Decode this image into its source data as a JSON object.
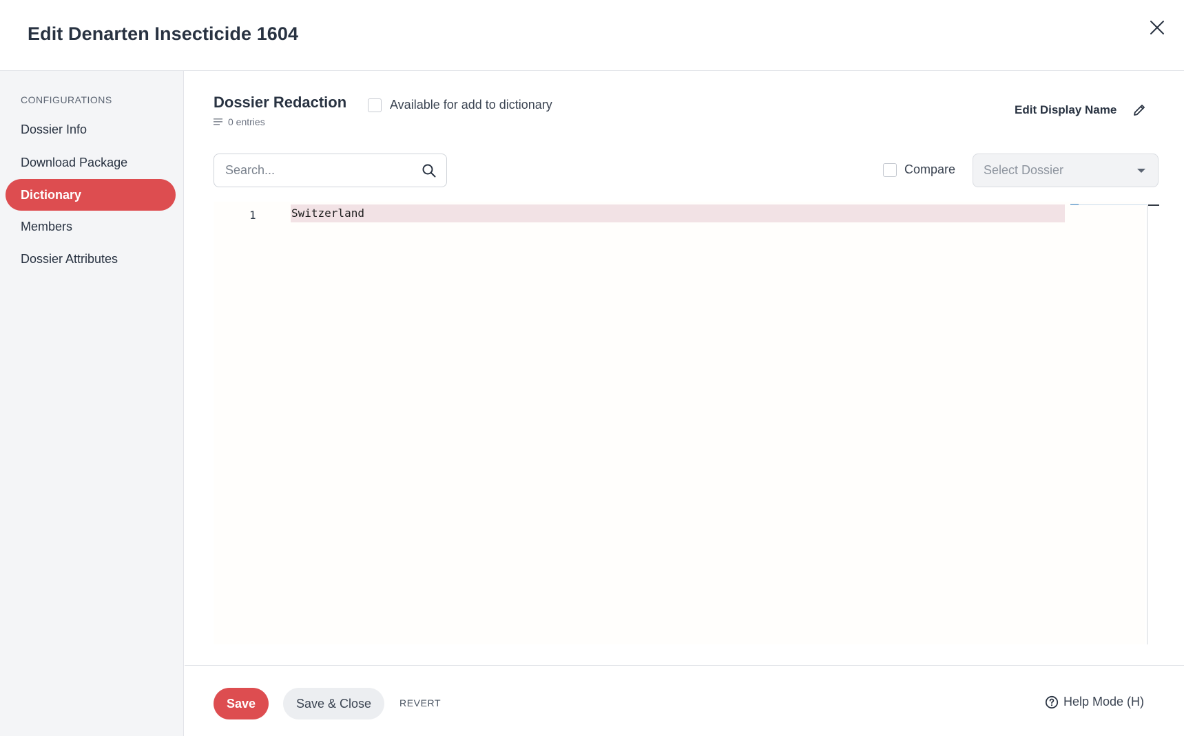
{
  "header": {
    "title": "Edit Denarten Insecticide 1604",
    "close_icon": "close-icon"
  },
  "sidebar": {
    "heading": "CONFIGURATIONS",
    "items": [
      {
        "label": "Dossier Info",
        "active": false
      },
      {
        "label": "Download Package",
        "active": false
      },
      {
        "label": "Dictionary",
        "active": true
      },
      {
        "label": "Members",
        "active": false
      },
      {
        "label": "Dossier Attributes",
        "active": false
      }
    ],
    "active_color": "#dd4d50"
  },
  "dictionary": {
    "title": "Dossier Redaction",
    "entries_label": "0 entries",
    "available_label": "Available for add to dictionary",
    "available_checked": false,
    "edit_display_name_label": "Edit Display Name"
  },
  "search": {
    "placeholder": "Search...",
    "value": ""
  },
  "compare": {
    "label": "Compare",
    "checked": false,
    "select_placeholder": "Select Dossier"
  },
  "editor": {
    "lines": [
      {
        "number": "1",
        "text": "Switzerland"
      }
    ]
  },
  "footer": {
    "save_label": "Save",
    "save_close_label": "Save & Close",
    "revert_label": "REVERT",
    "help_label": "Help Mode (H)"
  }
}
